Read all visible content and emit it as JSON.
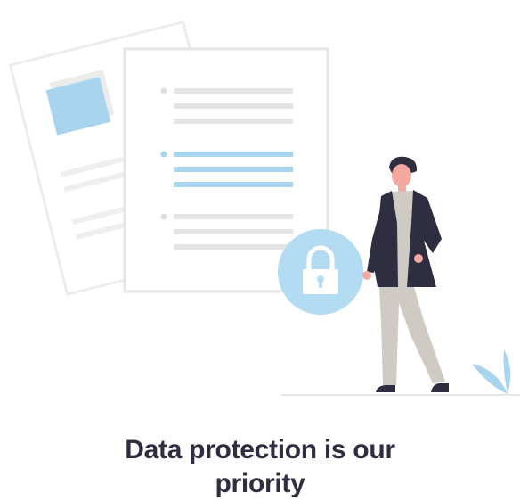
{
  "headline": {
    "line1": "Data protection is our",
    "line2": "priority"
  },
  "icons": {
    "documents": "documents-icon",
    "lock": "lock-icon",
    "person": "person-icon",
    "leaf": "leaf-icon"
  },
  "colors": {
    "accent_blue": "#a9d4ee",
    "lock_circle": "#b3dbf2",
    "document_border": "#e6e6e6",
    "line_gray": "#e2e2e2",
    "jacket": "#2f2e41",
    "pants": "#cfcac4",
    "skin": "#f4a8a0",
    "text": "#2f2e41"
  }
}
